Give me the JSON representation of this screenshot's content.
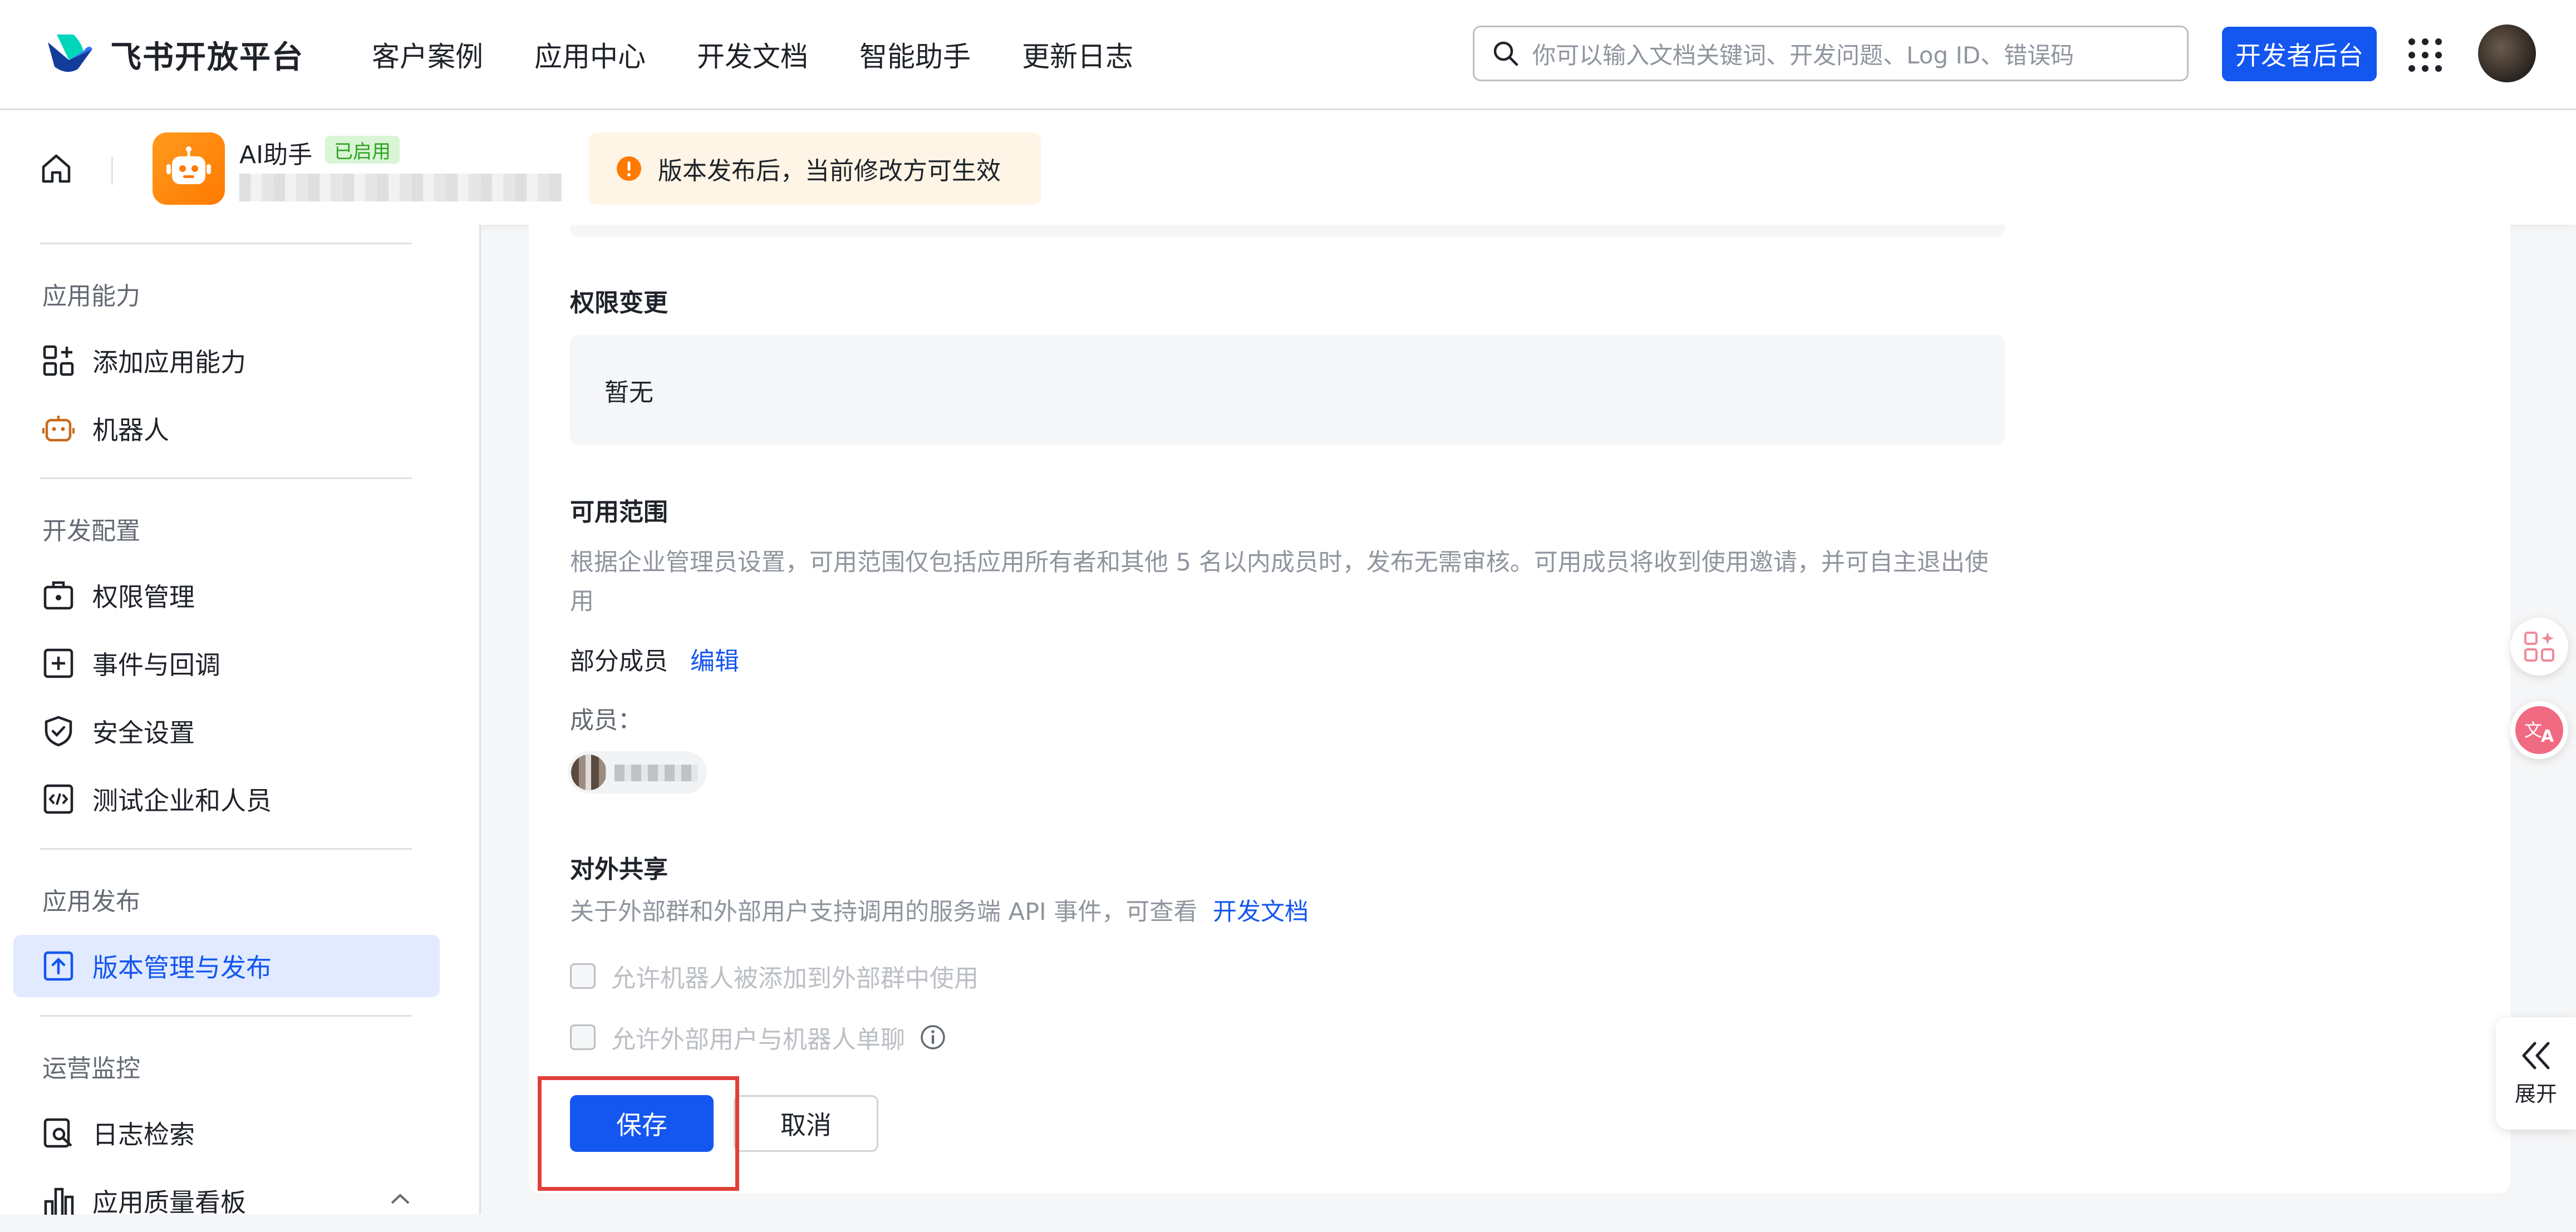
{
  "topbar": {
    "brand": "飞书开放平台",
    "nav": [
      "客户案例",
      "应用中心",
      "开发文档",
      "智能助手",
      "更新日志"
    ],
    "search_placeholder": "你可以输入文档关键词、开发问题、Log ID、错误码",
    "console_button": "开发者后台"
  },
  "app": {
    "name": "AI助手",
    "status_badge": "已启用",
    "notice": "版本发布后，当前修改方可生效"
  },
  "sidebar": {
    "sections": [
      {
        "title": "应用能力",
        "items": [
          "添加应用能力",
          "机器人"
        ]
      },
      {
        "title": "开发配置",
        "items": [
          "权限管理",
          "事件与回调",
          "安全设置",
          "测试企业和人员"
        ]
      },
      {
        "title": "应用发布",
        "items": [
          "版本管理与发布"
        ]
      },
      {
        "title": "运营监控",
        "items": [
          "日志检索",
          "应用质量看板"
        ]
      }
    ],
    "active_item": "版本管理与发布"
  },
  "main": {
    "permission_changes": {
      "title": "权限变更",
      "value": "暂无"
    },
    "scope": {
      "title": "可用范围",
      "description": "根据企业管理员设置，可用范围仅包括应用所有者和其他 5 名以内成员时，发布无需审核。可用成员将收到使用邀请，并可自主退出使用",
      "partial_members": "部分成员",
      "edit_link": "编辑",
      "members_label": "成员："
    },
    "sharing": {
      "title": "对外共享",
      "description": "关于外部群和外部用户支持调用的服务端 API 事件，可查看",
      "doc_link": "开发文档",
      "option_group": "允许机器人被添加到外部群中使用",
      "option_single": "允许外部用户与机器人单聊"
    },
    "save_button": "保存",
    "cancel_button": "取消"
  },
  "right_panel": {
    "expand_label": "展开"
  },
  "colors": {
    "primary": "#1456f0",
    "highlight_border": "#e0403a",
    "notice_bg": "#fff5e6",
    "badge_green": "#2ea121"
  }
}
